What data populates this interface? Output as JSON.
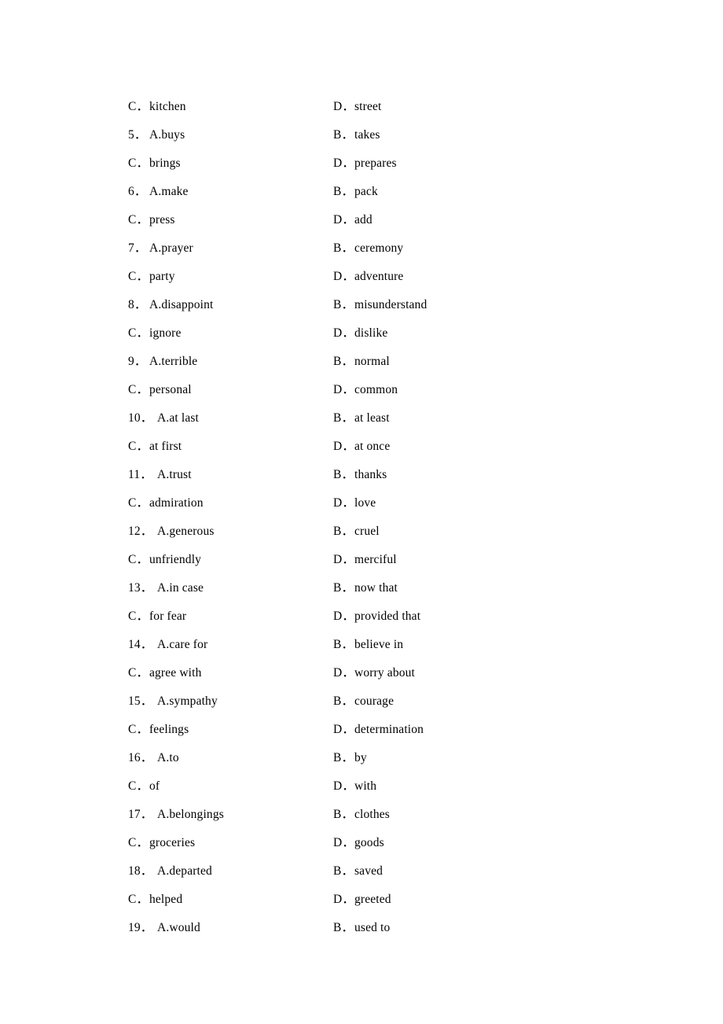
{
  "document": {
    "type": "multiple-choice-options-list",
    "page_background": "#ffffff",
    "text_color": "#000000"
  },
  "rows": [
    {
      "left": {
        "kind": "option",
        "marker": "C．",
        "text": "kitchen"
      },
      "right": {
        "kind": "option",
        "marker": "D．",
        "text": "street"
      }
    },
    {
      "left": {
        "kind": "question",
        "number": "5．",
        "marker": "A.",
        "text": "buys"
      },
      "right": {
        "kind": "option",
        "marker": "B．",
        "text": "takes"
      }
    },
    {
      "left": {
        "kind": "option",
        "marker": "C．",
        "text": "brings"
      },
      "right": {
        "kind": "option",
        "marker": "D．",
        "text": "prepares"
      }
    },
    {
      "left": {
        "kind": "question",
        "number": "6．",
        "marker": "A.",
        "text": "make"
      },
      "right": {
        "kind": "option",
        "marker": "B．",
        "text": "pack"
      }
    },
    {
      "left": {
        "kind": "option",
        "marker": "C．",
        "text": "press"
      },
      "right": {
        "kind": "option",
        "marker": "D．",
        "text": "add"
      }
    },
    {
      "left": {
        "kind": "question",
        "number": "7．",
        "marker": "A.",
        "text": "prayer"
      },
      "right": {
        "kind": "option",
        "marker": "B．",
        "text": "ceremony"
      }
    },
    {
      "left": {
        "kind": "option",
        "marker": "C．",
        "text": "party"
      },
      "right": {
        "kind": "option",
        "marker": "D．",
        "text": "adventure"
      }
    },
    {
      "left": {
        "kind": "question",
        "number": "8．",
        "marker": "A.",
        "text": "disappoint"
      },
      "right": {
        "kind": "option",
        "marker": "B．",
        "text": "misunderstand"
      }
    },
    {
      "left": {
        "kind": "option",
        "marker": "C．",
        "text": "ignore"
      },
      "right": {
        "kind": "option",
        "marker": "D．",
        "text": "dislike"
      }
    },
    {
      "left": {
        "kind": "question",
        "number": "9．",
        "marker": "A.",
        "text": "terrible"
      },
      "right": {
        "kind": "option",
        "marker": "B．",
        "text": "normal"
      }
    },
    {
      "left": {
        "kind": "option",
        "marker": "C．",
        "text": "personal"
      },
      "right": {
        "kind": "option",
        "marker": "D．",
        "text": "common"
      }
    },
    {
      "left": {
        "kind": "question",
        "number": "10．",
        "marker": "A.",
        "text": "at last"
      },
      "right": {
        "kind": "option",
        "marker": "B．",
        "text": "at least"
      }
    },
    {
      "left": {
        "kind": "option",
        "marker": "C．",
        "text": "at first"
      },
      "right": {
        "kind": "option",
        "marker": "D．",
        "text": "at once"
      }
    },
    {
      "left": {
        "kind": "question",
        "number": "11．",
        "marker": "A.",
        "text": "trust"
      },
      "right": {
        "kind": "option",
        "marker": "B．",
        "text": "thanks"
      }
    },
    {
      "left": {
        "kind": "option",
        "marker": "C．",
        "text": "admiration"
      },
      "right": {
        "kind": "option",
        "marker": "D．",
        "text": "love"
      }
    },
    {
      "left": {
        "kind": "question",
        "number": "12．",
        "marker": "A.",
        "text": "generous"
      },
      "right": {
        "kind": "option",
        "marker": "B．",
        "text": "cruel"
      }
    },
    {
      "left": {
        "kind": "option",
        "marker": "C．",
        "text": "unfriendly"
      },
      "right": {
        "kind": "option",
        "marker": "D．",
        "text": "merciful"
      }
    },
    {
      "left": {
        "kind": "question",
        "number": "13．",
        "marker": "A.",
        "text": "in case"
      },
      "right": {
        "kind": "option",
        "marker": "B．",
        "text": "now that"
      }
    },
    {
      "left": {
        "kind": "option",
        "marker": "C．",
        "text": "for fear"
      },
      "right": {
        "kind": "option",
        "marker": "D．",
        "text": "provided that"
      }
    },
    {
      "left": {
        "kind": "question",
        "number": "14．",
        "marker": "A.",
        "text": "care for"
      },
      "right": {
        "kind": "option",
        "marker": "B．",
        "text": "believe in"
      }
    },
    {
      "left": {
        "kind": "option",
        "marker": "C．",
        "text": "agree with"
      },
      "right": {
        "kind": "option",
        "marker": "D．",
        "text": "worry about"
      }
    },
    {
      "left": {
        "kind": "question",
        "number": "15．",
        "marker": "A.",
        "text": "sympathy"
      },
      "right": {
        "kind": "option",
        "marker": "B．",
        "text": "courage"
      }
    },
    {
      "left": {
        "kind": "option",
        "marker": "C．",
        "text": "feelings"
      },
      "right": {
        "kind": "option",
        "marker": "D．",
        "text": "determination"
      }
    },
    {
      "left": {
        "kind": "question",
        "number": "16．",
        "marker": "A.",
        "text": "to"
      },
      "right": {
        "kind": "option",
        "marker": "B．",
        "text": "by"
      }
    },
    {
      "left": {
        "kind": "option",
        "marker": "C．",
        "text": "of"
      },
      "right": {
        "kind": "option",
        "marker": "D．",
        "text": "with"
      }
    },
    {
      "left": {
        "kind": "question",
        "number": "17．",
        "marker": "A.",
        "text": "belongings"
      },
      "right": {
        "kind": "option",
        "marker": "B．",
        "text": "clothes"
      }
    },
    {
      "left": {
        "kind": "option",
        "marker": "C．",
        "text": "groceries"
      },
      "right": {
        "kind": "option",
        "marker": "D．",
        "text": "goods"
      }
    },
    {
      "left": {
        "kind": "question",
        "number": "18．",
        "marker": "A.",
        "text": "departed"
      },
      "right": {
        "kind": "option",
        "marker": "B．",
        "text": "saved"
      }
    },
    {
      "left": {
        "kind": "option",
        "marker": "C．",
        "text": "helped"
      },
      "right": {
        "kind": "option",
        "marker": "D．",
        "text": "greeted"
      }
    },
    {
      "left": {
        "kind": "question",
        "number": "19．",
        "marker": "A.",
        "text": "would"
      },
      "right": {
        "kind": "option",
        "marker": "B．",
        "text": "used to"
      }
    }
  ]
}
